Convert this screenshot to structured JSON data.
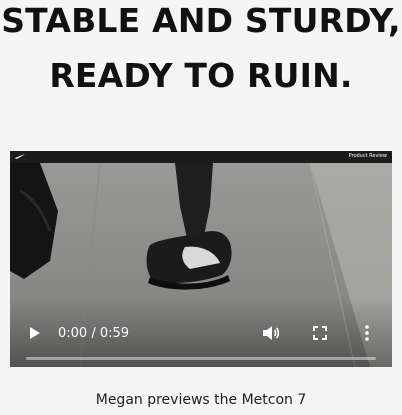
{
  "headline": {
    "line1": "STABLE AND STURDY,",
    "line2": "READY TO RUIN."
  },
  "video": {
    "tag": "Product Review",
    "brand_icon": "nike-swoosh-icon",
    "time_display": "0:00 / 0:59",
    "progress": 0,
    "icons": {
      "play": "play-icon",
      "volume": "volume-icon",
      "fullscreen": "fullscreen-icon",
      "menu": "more-vertical-icon"
    }
  },
  "caption": "Megan previews the Metcon 7",
  "colors": {
    "background": "#f5f5f5",
    "headline": "#111111",
    "controls": "#ffffff"
  }
}
